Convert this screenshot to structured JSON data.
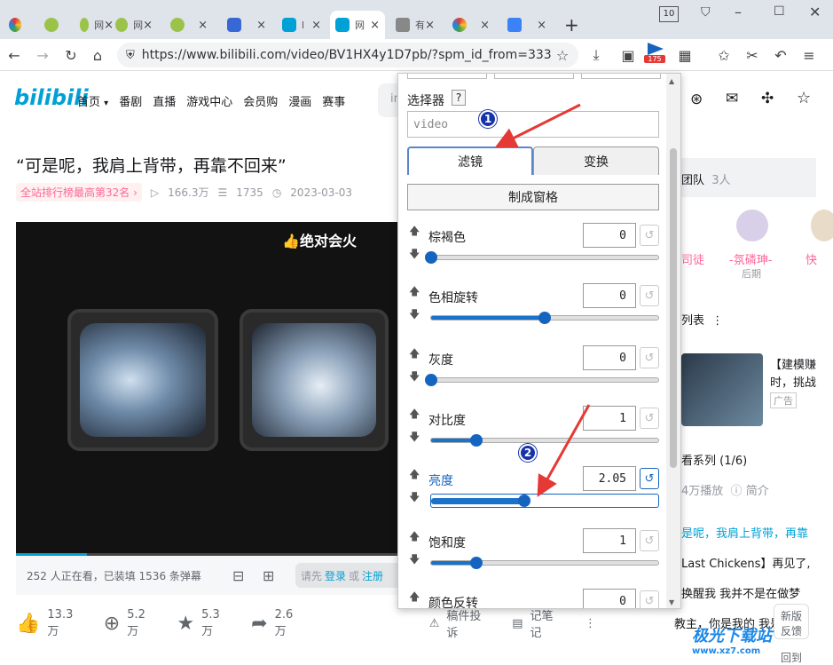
{
  "browser": {
    "tabs": [
      {
        "label": ""
      },
      {
        "label": ""
      },
      {
        "label": "网"
      },
      {
        "label": "网"
      },
      {
        "label": ""
      },
      {
        "label": "l"
      },
      {
        "label": "网"
      },
      {
        "label": "有"
      },
      {
        "label": ""
      },
      {
        "label": ""
      }
    ],
    "tab_count": "10",
    "url": "https://www.bilibili.com/video/BV1HX4y1D7pb/?spm_id_from=333",
    "ext_badge": "175"
  },
  "site": {
    "logo": "bilibili",
    "nav": [
      "首页",
      "番剧",
      "直播",
      "游戏中心",
      "会员购",
      "漫画",
      "赛事"
    ],
    "search_placeholder": "in"
  },
  "video": {
    "title": "“可是呢，我肩上背带，再靠不回来”",
    "rank": "全站排行榜最高第32名",
    "views": "166.3万",
    "danmaku_count": "1735",
    "date": "2023-03-03",
    "watermark": "绝对会火",
    "watching": "252 人正在看，已装填 1536 条弹幕",
    "login_prefix": "请先",
    "login": "登录",
    "or": "或",
    "register": "注册"
  },
  "actions": {
    "like": "13.3万",
    "coin": "5.2万",
    "fav": "5.3万",
    "share": "2.6万",
    "report": "稿件投诉",
    "notes": "记笔记"
  },
  "right": {
    "team": "团队",
    "team_count": "3人",
    "member1": "司徒",
    "member2": "-氛磷珅-",
    "member2_role": "后期",
    "member3": "快",
    "list": "列表",
    "ad_title1": "【建模赚",
    "ad_title2": "时，挑战",
    "ad_tag": "广告",
    "series": "看系列 (1/6)",
    "plays": "4万播放",
    "intro": "简介",
    "ep1": "是呢，我肩上背带，再靠",
    "ep2": "Last Chickens】再见了,",
    "ep3": "换醒我 我并不是在做梦",
    "ep4": "教主，你是我的  我是",
    "newver1": "新版",
    "newver2": "反馈",
    "back": "回到"
  },
  "panel": {
    "selector_label": "选择器",
    "help": "?",
    "selector_value": "video",
    "tab_filters": "滤镜",
    "tab_transform": "变换",
    "make_grid": "制成窗格",
    "filters": [
      {
        "label": "棕褐色",
        "value": "0",
        "level": 0.0
      },
      {
        "label": "色相旋转",
        "value": "0",
        "level": 0.5
      },
      {
        "label": "灰度",
        "value": "0",
        "level": 0.0
      },
      {
        "label": "对比度",
        "value": "1",
        "level": 0.2
      },
      {
        "label": "亮度",
        "value": "2.05",
        "level": 0.41
      },
      {
        "label": "饱和度",
        "value": "1",
        "level": 0.2
      },
      {
        "label": "颜色反转",
        "value": "0",
        "level": 0.0
      }
    ],
    "annotation1": "1",
    "annotation2": "2"
  },
  "brand": {
    "name": "极光下载站",
    "url": "www.xz7.com"
  },
  "colors": {
    "bili_blue": "#00a1d6",
    "accent": "#1565c0",
    "annotation": "#e53935"
  }
}
